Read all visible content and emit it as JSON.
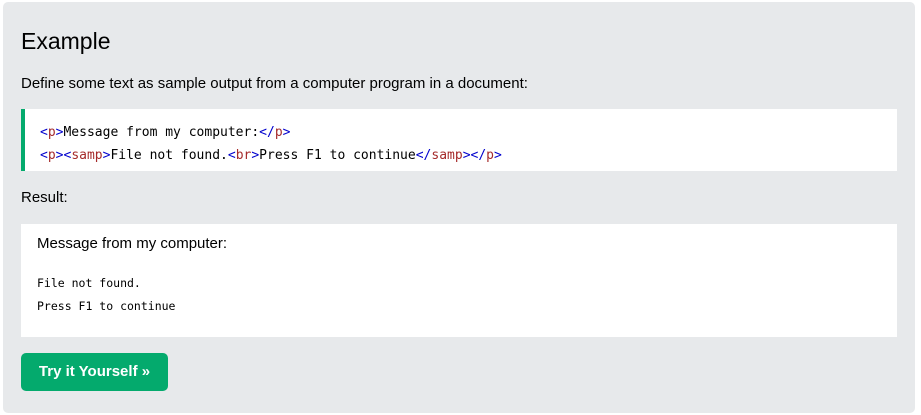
{
  "example": {
    "title": "Example",
    "description": "Define some text as sample output from a computer program in a document:",
    "code_lines": [
      [
        {
          "kind": "bracket",
          "text": "<"
        },
        {
          "kind": "tagname",
          "text": "p"
        },
        {
          "kind": "bracket",
          "text": ">"
        },
        {
          "kind": "text",
          "text": "Message from my computer:"
        },
        {
          "kind": "bracket",
          "text": "</"
        },
        {
          "kind": "tagname",
          "text": "p"
        },
        {
          "kind": "bracket",
          "text": ">"
        }
      ],
      [
        {
          "kind": "bracket",
          "text": "<"
        },
        {
          "kind": "tagname",
          "text": "p"
        },
        {
          "kind": "bracket",
          "text": "><"
        },
        {
          "kind": "tagname",
          "text": "samp"
        },
        {
          "kind": "bracket",
          "text": ">"
        },
        {
          "kind": "text",
          "text": "File not found."
        },
        {
          "kind": "bracket",
          "text": "<"
        },
        {
          "kind": "tagname",
          "text": "br"
        },
        {
          "kind": "bracket",
          "text": ">"
        },
        {
          "kind": "text",
          "text": "Press F1 to continue"
        },
        {
          "kind": "bracket",
          "text": "</"
        },
        {
          "kind": "tagname",
          "text": "samp"
        },
        {
          "kind": "bracket",
          "text": "></"
        },
        {
          "kind": "tagname",
          "text": "p"
        },
        {
          "kind": "bracket",
          "text": ">"
        }
      ]
    ],
    "result_label": "Result:",
    "result": {
      "paragraph": "Message from my computer:",
      "samp_line_1": "File not found.",
      "samp_line_2": "Press F1 to continue"
    },
    "try_button_label": "Try it Yourself »"
  },
  "colors": {
    "panel_background": "#e7e9eb",
    "accent_green": "#04aa6d",
    "tag_bracket": "#0000cd",
    "tag_name": "#a52a2a"
  }
}
